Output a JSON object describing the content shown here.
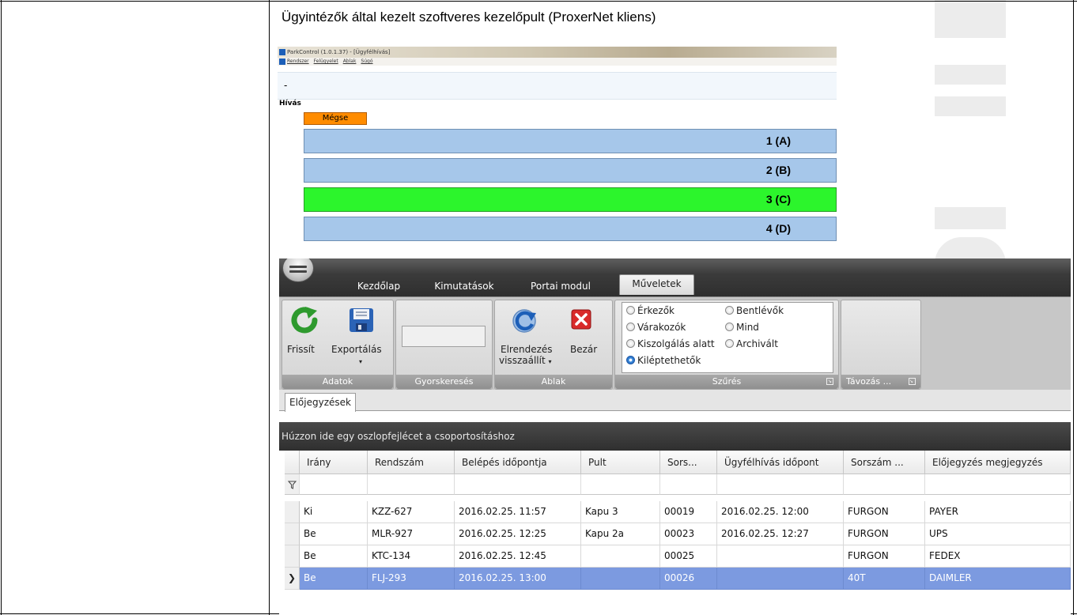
{
  "doc": {
    "title": "Ügyintézők által kezelt szoftveres kezelőpult (ProxerNet kliens)"
  },
  "parkcontrol": {
    "window_title": "ParkControl (1.0.1.37) - [Ügyfélhívás]",
    "menu": [
      "Rendszer",
      "Felügyelet",
      "Ablak",
      "Súgó"
    ],
    "status_text": "-",
    "section_label": "Hívás",
    "cancel_button": "Mégse",
    "answers": [
      {
        "label": "1 (A)",
        "highlighted": false
      },
      {
        "label": "2 (B)",
        "highlighted": false
      },
      {
        "label": "3 (C)",
        "highlighted": true
      },
      {
        "label": "4 (D)",
        "highlighted": false
      }
    ]
  },
  "manager": {
    "tabs": [
      {
        "label": "Kezdőlap",
        "active": false
      },
      {
        "label": "Kimutatások",
        "active": false
      },
      {
        "label": "Portai modul",
        "active": false
      },
      {
        "label": "Műveletek",
        "active": true
      }
    ],
    "groups": {
      "adatok": {
        "label": "Adatok",
        "refresh": "Frissít",
        "export": "Exportálás"
      },
      "gyorskereses": {
        "label": "Gyorskeresés"
      },
      "ablak": {
        "label": "Ablak",
        "layout_line1": "Elrendezés",
        "layout_line2": "visszaállít",
        "close": "Bezár"
      },
      "szures": {
        "label": "Szűrés",
        "options": [
          {
            "label": "Érkezők",
            "checked": false
          },
          {
            "label": "Bentlévők",
            "checked": false
          },
          {
            "label": "Várakozók",
            "checked": false
          },
          {
            "label": "Mind",
            "checked": false
          },
          {
            "label": "Kiszolgálás alatt",
            "checked": false
          },
          {
            "label": "Archivált",
            "checked": false
          },
          {
            "label": "Kiléptethetők",
            "checked": true
          }
        ]
      },
      "tavozas": {
        "label": "Távozás ..."
      }
    },
    "subtab": "Előjegyzések",
    "groupby_hint": "Húzzon ide egy oszlopfejlécet a csoportosításhoz",
    "columns": [
      "Irány",
      "Rendszám",
      "Belépés időpontja",
      "Pult",
      "Sors...",
      "Ügyfélhívás időpont",
      "Sorszám ...",
      "Előjegyzés megjegyzés"
    ],
    "rows": [
      {
        "selected": false,
        "cells": [
          "Ki",
          "KZZ-627",
          "2016.02.25. 11:57",
          "Kapu 3",
          "00019",
          "2016.02.25. 12:00",
          "FURGON",
          "PAYER"
        ]
      },
      {
        "selected": false,
        "cells": [
          "Be",
          "MLR-927",
          "2016.02.25. 12:25",
          "Kapu 2a",
          "00023",
          "2016.02.25. 12:27",
          "FURGON",
          "UPS"
        ]
      },
      {
        "selected": false,
        "cells": [
          "Be",
          "KTC-134",
          "2016.02.25. 12:45",
          "",
          "00025",
          "",
          "FURGON",
          "FEDEX"
        ]
      },
      {
        "selected": true,
        "cells": [
          "Be",
          "FLJ-293",
          "2016.02.25. 13:00",
          "",
          "00026",
          "",
          "40T",
          "DAIMLER"
        ]
      }
    ]
  }
}
